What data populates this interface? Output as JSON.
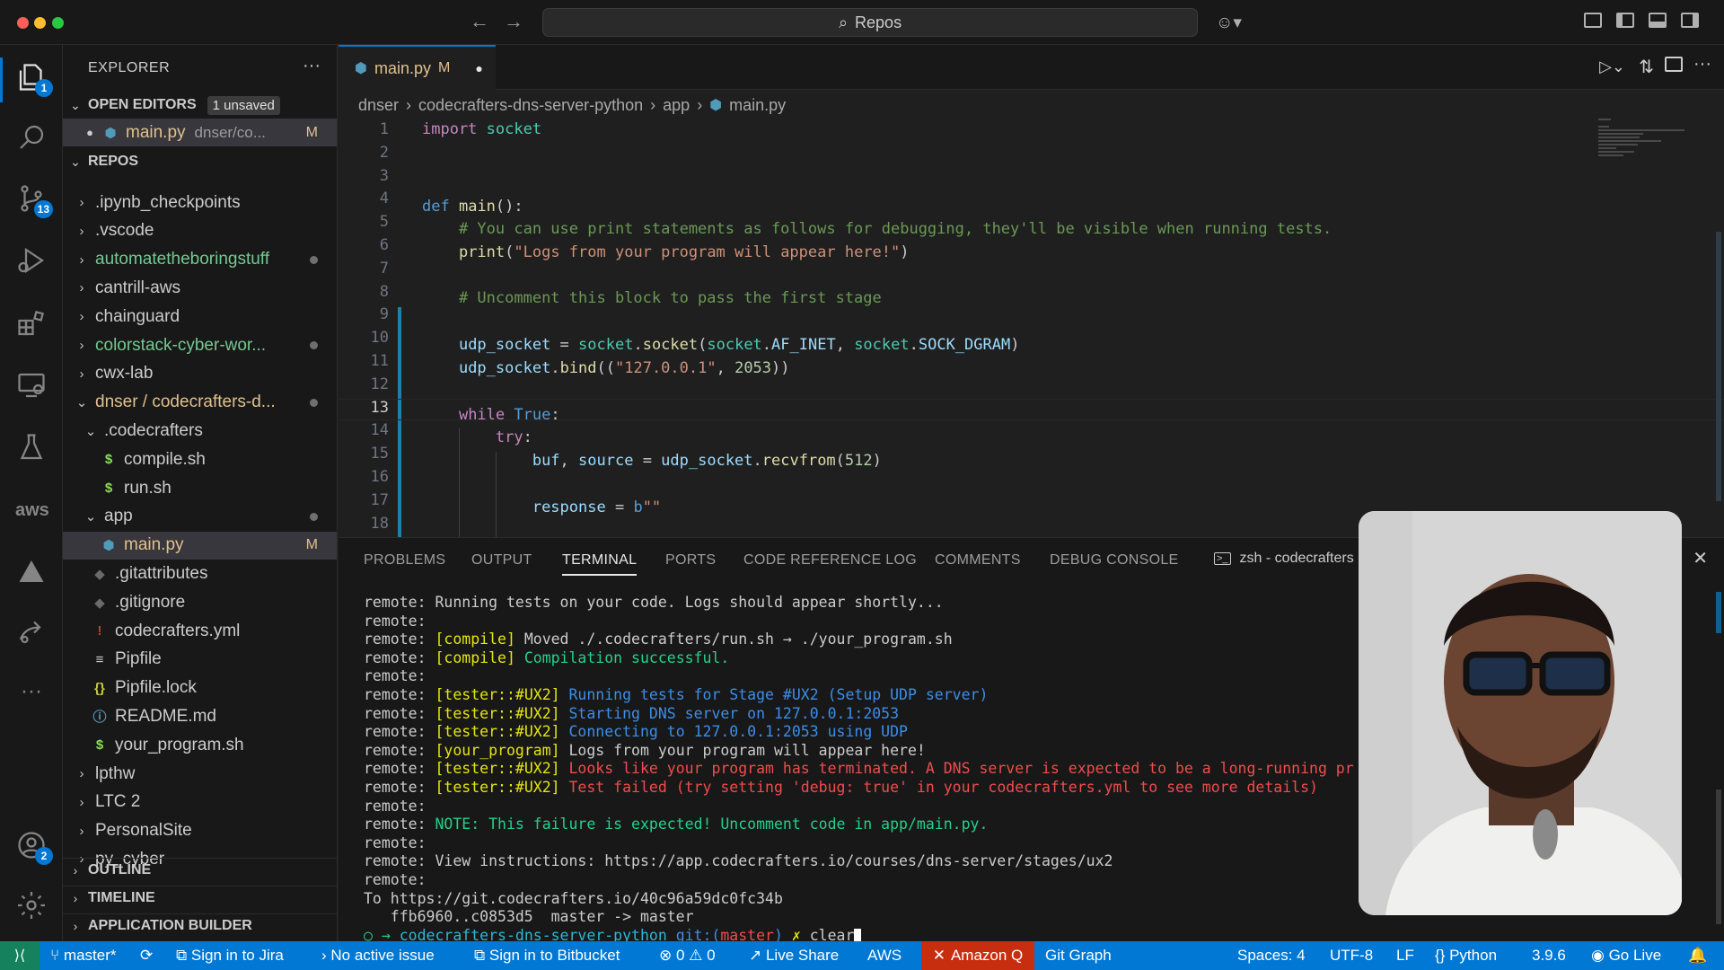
{
  "window": {
    "search_label": "Repos"
  },
  "activity": {
    "explorer_badge": "1",
    "scm_badge": "13",
    "accounts_badge": "2"
  },
  "sidebar": {
    "title": "EXPLORER",
    "open_editors_label": "OPEN EDITORS",
    "unsaved_badge": "1 unsaved",
    "open_editor": {
      "name": "main.py",
      "path": "dnser/co...",
      "status": "M"
    },
    "repos_label": "REPOS",
    "tree": [
      {
        "label": ".ipynb_checkpoints",
        "type": "folder",
        "status": ""
      },
      {
        "label": ".vscode",
        "type": "folder",
        "status": ""
      },
      {
        "label": "automatetheboringstuff",
        "type": "folder",
        "status": "dot"
      },
      {
        "label": "cantrill-aws",
        "type": "folder",
        "status": ""
      },
      {
        "label": "chainguard",
        "type": "folder",
        "status": ""
      },
      {
        "label": "colorstack-cyber-wor...",
        "type": "folder",
        "status": "dot"
      },
      {
        "label": "cwx-lab",
        "type": "folder",
        "status": ""
      },
      {
        "label": "dnser / codecrafters-d...",
        "type": "folder-open",
        "status": "dot"
      },
      {
        "label": ".codecrafters",
        "type": "folder-open",
        "status": ""
      },
      {
        "label": "compile.sh",
        "type": "sh",
        "status": ""
      },
      {
        "label": "run.sh",
        "type": "sh",
        "status": ""
      },
      {
        "label": "app",
        "type": "folder-open",
        "status": "dot"
      },
      {
        "label": "main.py",
        "type": "py",
        "status": "M"
      },
      {
        "label": ".gitattributes",
        "type": "git",
        "status": ""
      },
      {
        "label": ".gitignore",
        "type": "git",
        "status": ""
      },
      {
        "label": "codecrafters.yml",
        "type": "yml",
        "status": ""
      },
      {
        "label": "Pipfile",
        "type": "txt",
        "status": ""
      },
      {
        "label": "Pipfile.lock",
        "type": "json",
        "status": ""
      },
      {
        "label": "README.md",
        "type": "md",
        "status": ""
      },
      {
        "label": "your_program.sh",
        "type": "sh",
        "status": ""
      },
      {
        "label": "lpthw",
        "type": "folder",
        "status": ""
      },
      {
        "label": "LTC 2",
        "type": "folder",
        "status": ""
      },
      {
        "label": "PersonalSite",
        "type": "folder",
        "status": ""
      },
      {
        "label": "py_cyber",
        "type": "folder",
        "status": ""
      }
    ],
    "outline_label": "OUTLINE",
    "timeline_label": "TIMELINE",
    "app_builder_label": "APPLICATION BUILDER"
  },
  "editor": {
    "tab_name": "main.py",
    "tab_status": "M",
    "breadcrumb": [
      "dnser",
      "codecrafters-dns-server-python",
      "app",
      "main.py"
    ],
    "line_numbers": [
      "1",
      "2",
      "3",
      "4",
      "5",
      "6",
      "7",
      "8",
      "9",
      "10",
      "11",
      "12",
      "13",
      "14",
      "15",
      "16",
      "17",
      "18"
    ],
    "current_line": "13"
  },
  "panel": {
    "tabs": [
      "PROBLEMS",
      "OUTPUT",
      "TERMINAL",
      "PORTS",
      "CODE REFERENCE LOG",
      "COMMENTS",
      "DEBUG CONSOLE"
    ],
    "terminal_name": "zsh - codecrafters",
    "lines": [
      [
        [
          "remote: Running tests on your code. Logs should appear shortly...",
          ""
        ]
      ],
      [
        [
          "remote:",
          ""
        ]
      ],
      [
        [
          "remote: ",
          ""
        ],
        [
          "[compile]",
          "y"
        ],
        [
          " Moved ./.codecrafters/run.sh → ./your_program.sh",
          ""
        ]
      ],
      [
        [
          "remote: ",
          ""
        ],
        [
          "[compile]",
          "y"
        ],
        [
          " Compilation successful.",
          "g"
        ]
      ],
      [
        [
          "remote:",
          ""
        ]
      ],
      [
        [
          "remote: ",
          ""
        ],
        [
          "[tester::#UX2]",
          "y"
        ],
        [
          " Running tests for Stage #UX2 (Setup UDP server)",
          "b"
        ]
      ],
      [
        [
          "remote: ",
          ""
        ],
        [
          "[tester::#UX2]",
          "y"
        ],
        [
          " Starting DNS server on 127.0.0.1:2053",
          "b"
        ]
      ],
      [
        [
          "remote: ",
          ""
        ],
        [
          "[tester::#UX2]",
          "y"
        ],
        [
          " Connecting to 127.0.0.1:2053 using UDP",
          "b"
        ]
      ],
      [
        [
          "remote: ",
          ""
        ],
        [
          "[your_program]",
          "y"
        ],
        [
          " Logs from your program will appear here!",
          ""
        ]
      ],
      [
        [
          "remote: ",
          ""
        ],
        [
          "[tester::#UX2]",
          "y"
        ],
        [
          " Looks like your program has terminated. A DNS server is expected to be a long-running pr",
          "r"
        ]
      ],
      [
        [
          "remote: ",
          ""
        ],
        [
          "[tester::#UX2]",
          "y"
        ],
        [
          " Test failed (try setting 'debug: true' in your codecrafters.yml to see more details)",
          "r"
        ]
      ],
      [
        [
          "remote:",
          ""
        ]
      ],
      [
        [
          "remote: ",
          ""
        ],
        [
          "NOTE: This failure is expected! Uncomment code in app/main.py.",
          "g"
        ]
      ],
      [
        [
          "remote:",
          ""
        ]
      ],
      [
        [
          "remote: View instructions: https://app.codecrafters.io/courses/dns-server/stages/ux2",
          ""
        ]
      ],
      [
        [
          "remote:",
          ""
        ]
      ],
      [
        [
          "To https://git.codecrafters.io/40c96a59dc0fc34b",
          ""
        ]
      ],
      [
        [
          "   ffb6960..c0853d5  master -> master",
          ""
        ]
      ],
      [
        [
          "○ → ",
          "g"
        ],
        [
          "codecrafters-dns-server-python",
          "c"
        ],
        [
          " git:(",
          "b"
        ],
        [
          "master",
          "r"
        ],
        [
          ")",
          "b"
        ],
        [
          " ✗ ",
          "y"
        ],
        [
          "clear",
          ""
        ]
      ]
    ]
  },
  "statusbar": {
    "branch": "master*",
    "jira": "Sign in to Jira",
    "issue": "No active issue",
    "bitbucket": "Sign in to Bitbucket",
    "errors": "0",
    "warnings": "0",
    "liveshare": "Live Share",
    "aws": "AWS",
    "amazonq": "Amazon Q",
    "gitgraph": "Git Graph",
    "spaces": "Spaces: 4",
    "encoding": "UTF-8",
    "eol": "LF",
    "language": "Python",
    "version": "3.9.6",
    "golive": "Go Live"
  },
  "colors": {
    "accent": "#0078d4",
    "statusbar": "#0078d4",
    "amazonq": "#c72e0f",
    "remote": "#16825d"
  }
}
